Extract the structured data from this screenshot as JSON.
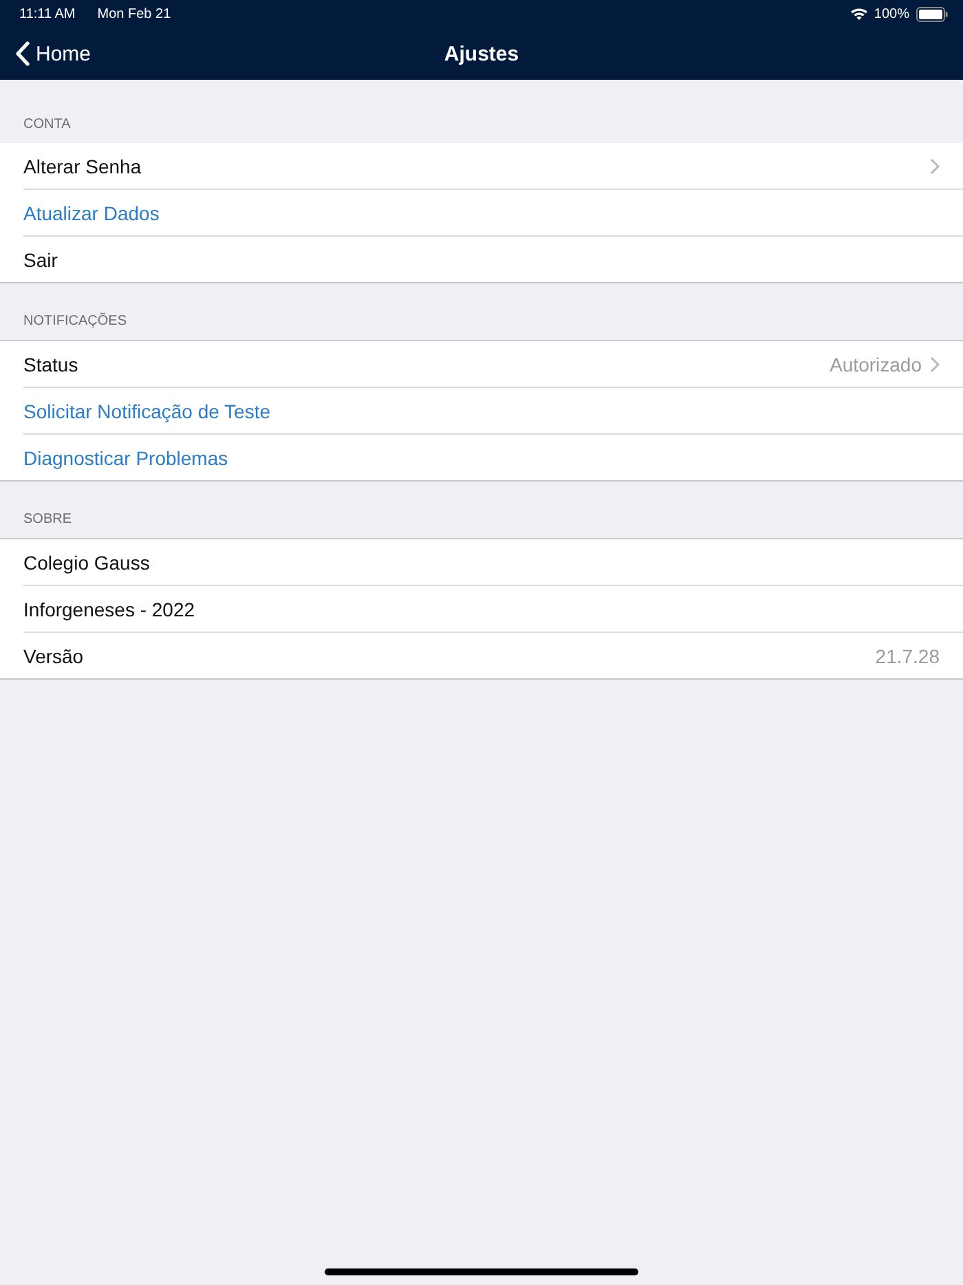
{
  "status_bar": {
    "time": "11:11 AM",
    "date": "Mon Feb 21",
    "battery": "100%"
  },
  "nav": {
    "back": "Home",
    "title": "Ajustes"
  },
  "sections": [
    {
      "header": "CONTA",
      "rows": [
        {
          "label": "Alterar Senha",
          "kind": "plain",
          "disclosure": true
        },
        {
          "label": "Atualizar Dados",
          "kind": "action",
          "disclosure": false
        },
        {
          "label": "Sair",
          "kind": "plain",
          "disclosure": false
        }
      ]
    },
    {
      "header": "NOTIFICAÇÕES",
      "rows": [
        {
          "label": "Status",
          "kind": "plain",
          "value": "Autorizado",
          "disclosure": true
        },
        {
          "label": "Solicitar Notificação de Teste",
          "kind": "action",
          "disclosure": false
        },
        {
          "label": "Diagnosticar Problemas",
          "kind": "action",
          "disclosure": false
        }
      ]
    },
    {
      "header": "SOBRE",
      "rows": [
        {
          "label": "Colegio Gauss",
          "kind": "plain",
          "disclosure": false
        },
        {
          "label": "Inforgeneses - 2022",
          "kind": "plain",
          "disclosure": false
        },
        {
          "label": "Versão",
          "kind": "plain",
          "value": "21.7.28",
          "disclosure": false
        }
      ]
    }
  ]
}
